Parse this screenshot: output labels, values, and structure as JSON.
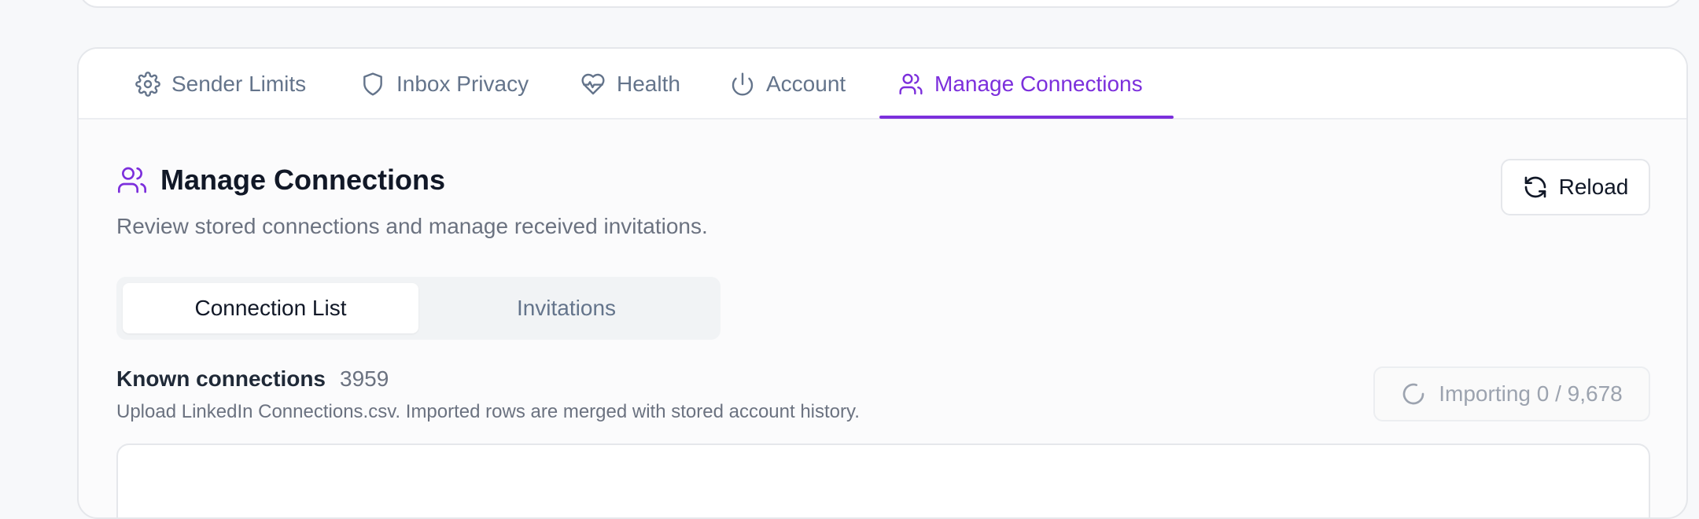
{
  "tabs": [
    {
      "label": "Sender Limits",
      "icon": "gear-icon",
      "active": false
    },
    {
      "label": "Inbox Privacy",
      "icon": "shield-icon",
      "active": false
    },
    {
      "label": "Health",
      "icon": "heart-pulse-icon",
      "active": false
    },
    {
      "label": "Account",
      "icon": "power-icon",
      "active": false
    },
    {
      "label": "Manage Connections",
      "icon": "users-icon",
      "active": true
    }
  ],
  "section": {
    "title": "Manage Connections",
    "icon": "users-icon",
    "description": "Review stored connections and manage received invitations."
  },
  "reload": {
    "label": "Reload",
    "icon": "refresh-icon"
  },
  "segments": [
    {
      "label": "Connection List",
      "active": true
    },
    {
      "label": "Invitations",
      "active": false
    }
  ],
  "known": {
    "label": "Known connections",
    "count": "3959",
    "help": "Upload LinkedIn Connections.csv. Imported rows are merged with stored account history."
  },
  "import": {
    "label": "Importing 0 / 9,678",
    "icon": "spinner-icon"
  },
  "colors": {
    "accent": "#7c2fdc",
    "muted_text": "#64748b",
    "heading_text": "#111827"
  }
}
